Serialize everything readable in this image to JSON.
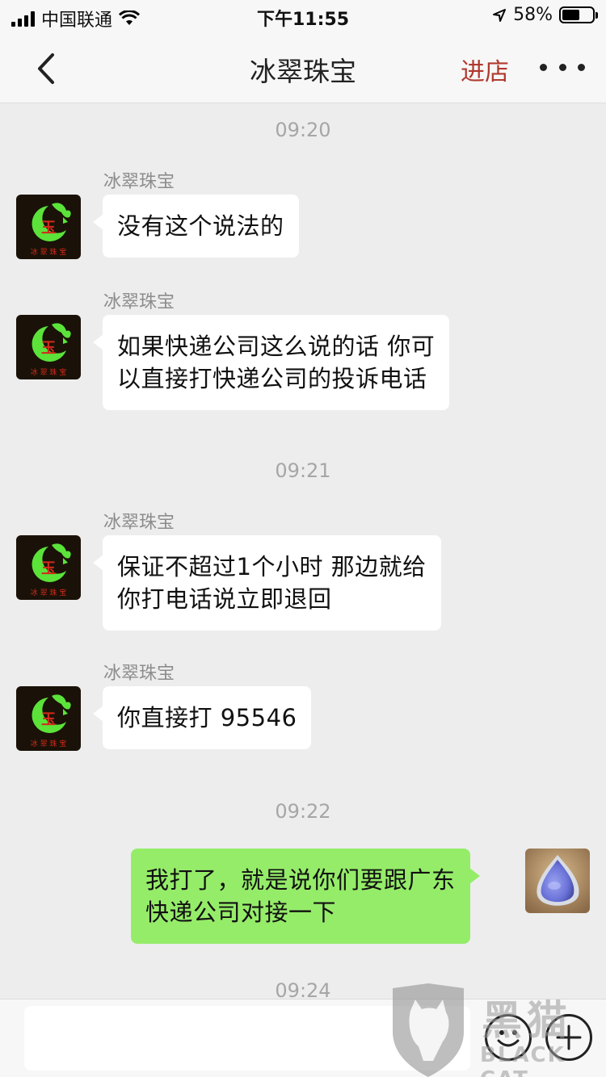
{
  "status_bar": {
    "carrier": "中国联通",
    "time": "下午11:55",
    "battery_percent": "58%",
    "battery_level": 0.58
  },
  "nav": {
    "title": "冰翠珠宝",
    "store_label": "进店"
  },
  "avatar": {
    "shop_text": "冰 翠 珠 宝",
    "logo_char": "玉"
  },
  "chat": {
    "timestamps": [
      "09:20",
      "09:21",
      "09:22",
      "09:24"
    ],
    "messages": [
      {
        "sender": "冰翠珠宝",
        "lines": [
          "没有这个说法的"
        ]
      },
      {
        "sender": "冰翠珠宝",
        "lines": [
          "如果快递公司这么说的话 你可",
          "以直接打快递公司的投诉电话"
        ]
      },
      {
        "sender": "冰翠珠宝",
        "lines": [
          "保证不超过1个小时 那边就给",
          "你打电话说立即退回"
        ]
      },
      {
        "sender": "冰翠珠宝",
        "lines": [
          "你直接打 95546"
        ]
      },
      {
        "lines": [
          "我打了，就是说你们要跟广东",
          "快递公司对接一下"
        ]
      }
    ]
  },
  "watermark": {
    "cn": "黑猫",
    "en": "BLACK CAT"
  },
  "colors": {
    "outgoing_bubble": "#95ec69",
    "store_link": "#b03a2e",
    "logo_green": "#5be33a"
  }
}
